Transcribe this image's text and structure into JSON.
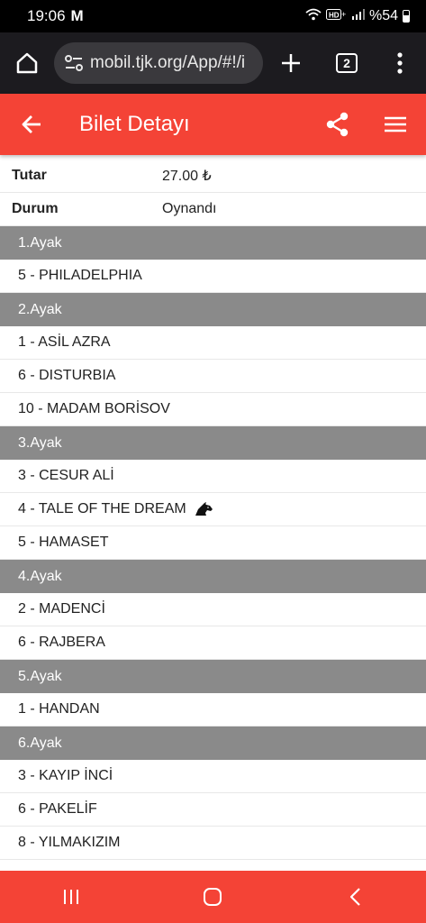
{
  "status_bar": {
    "time": "19:06",
    "notification": "M",
    "battery_text": "%54"
  },
  "browser": {
    "url": "mobil.tjk.org/App/#!/i",
    "tab_count": "2"
  },
  "header": {
    "title": "Bilet Detayı"
  },
  "ticket": {
    "amount_label": "Tutar",
    "amount_value": "27.00 ₺",
    "status_label": "Durum",
    "status_value": "Oynandı"
  },
  "legs": [
    {
      "title": "1.Ayak",
      "horses": [
        "5 - PHILADELPHIA"
      ]
    },
    {
      "title": "2.Ayak",
      "horses": [
        "1 - ASİL AZRA",
        "6 - DISTURBIA",
        "10 - MADAM BORİSOV"
      ]
    },
    {
      "title": "3.Ayak",
      "horses": [
        "3 - CESUR ALİ",
        "4 - TALE OF THE DREAM",
        "5 - HAMASET"
      ]
    },
    {
      "title": "4.Ayak",
      "horses": [
        "2 - MADENCİ",
        "6 - RAJBERA"
      ]
    },
    {
      "title": "5.Ayak",
      "horses": [
        "1 - HANDAN"
      ]
    },
    {
      "title": "6.Ayak",
      "horses": [
        "3 - KAYIP İNCİ",
        "6 - PAKELİF",
        "8 - YILMAKIZIM"
      ]
    }
  ],
  "colors": {
    "accent": "#f44336",
    "leg_header": "#8a8a8a",
    "browser_bar": "#1c1b1f"
  },
  "icons": {
    "horse_marker_on": "4 - TALE OF THE DREAM",
    "horse_marker_icon": "horse-head-icon"
  }
}
